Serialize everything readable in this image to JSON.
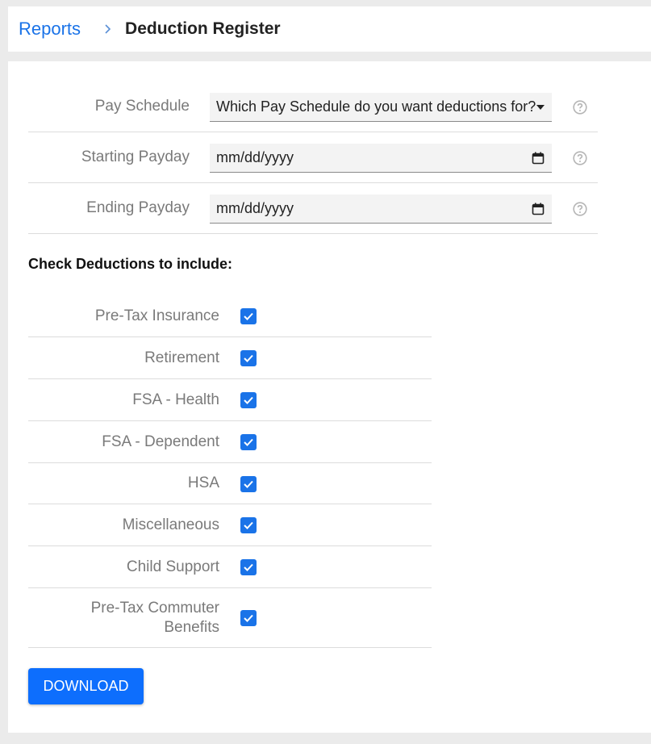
{
  "breadcrumb": {
    "parent": "Reports",
    "separator": "›",
    "current": "Deduction Register"
  },
  "form": {
    "pay_schedule": {
      "label": "Pay Schedule",
      "value": "Which Pay Schedule do you want deductions for?",
      "icon": "caret-down-icon"
    },
    "starting_payday": {
      "label": "Starting Payday",
      "placeholder": "mm/dd/yyyy",
      "icon": "calendar-icon"
    },
    "ending_payday": {
      "label": "Ending Payday",
      "placeholder": "mm/dd/yyyy",
      "icon": "calendar-icon"
    },
    "help_icon": "question-circle-icon"
  },
  "deductions": {
    "title": "Check Deductions to include:",
    "items": [
      {
        "label": "Pre-Tax Insurance",
        "checked": true
      },
      {
        "label": "Retirement",
        "checked": true
      },
      {
        "label": "FSA - Health",
        "checked": true
      },
      {
        "label": "FSA - Dependent",
        "checked": true
      },
      {
        "label": "HSA",
        "checked": true
      },
      {
        "label": "Miscellaneous",
        "checked": true
      },
      {
        "label": "Child Support",
        "checked": true
      },
      {
        "label": "Pre-Tax Commuter Benefits",
        "checked": true
      }
    ]
  },
  "actions": {
    "download_label": "Download"
  },
  "colors": {
    "accent": "#1a73e8",
    "button": "#0d6efd",
    "label": "#7a7a7a"
  }
}
